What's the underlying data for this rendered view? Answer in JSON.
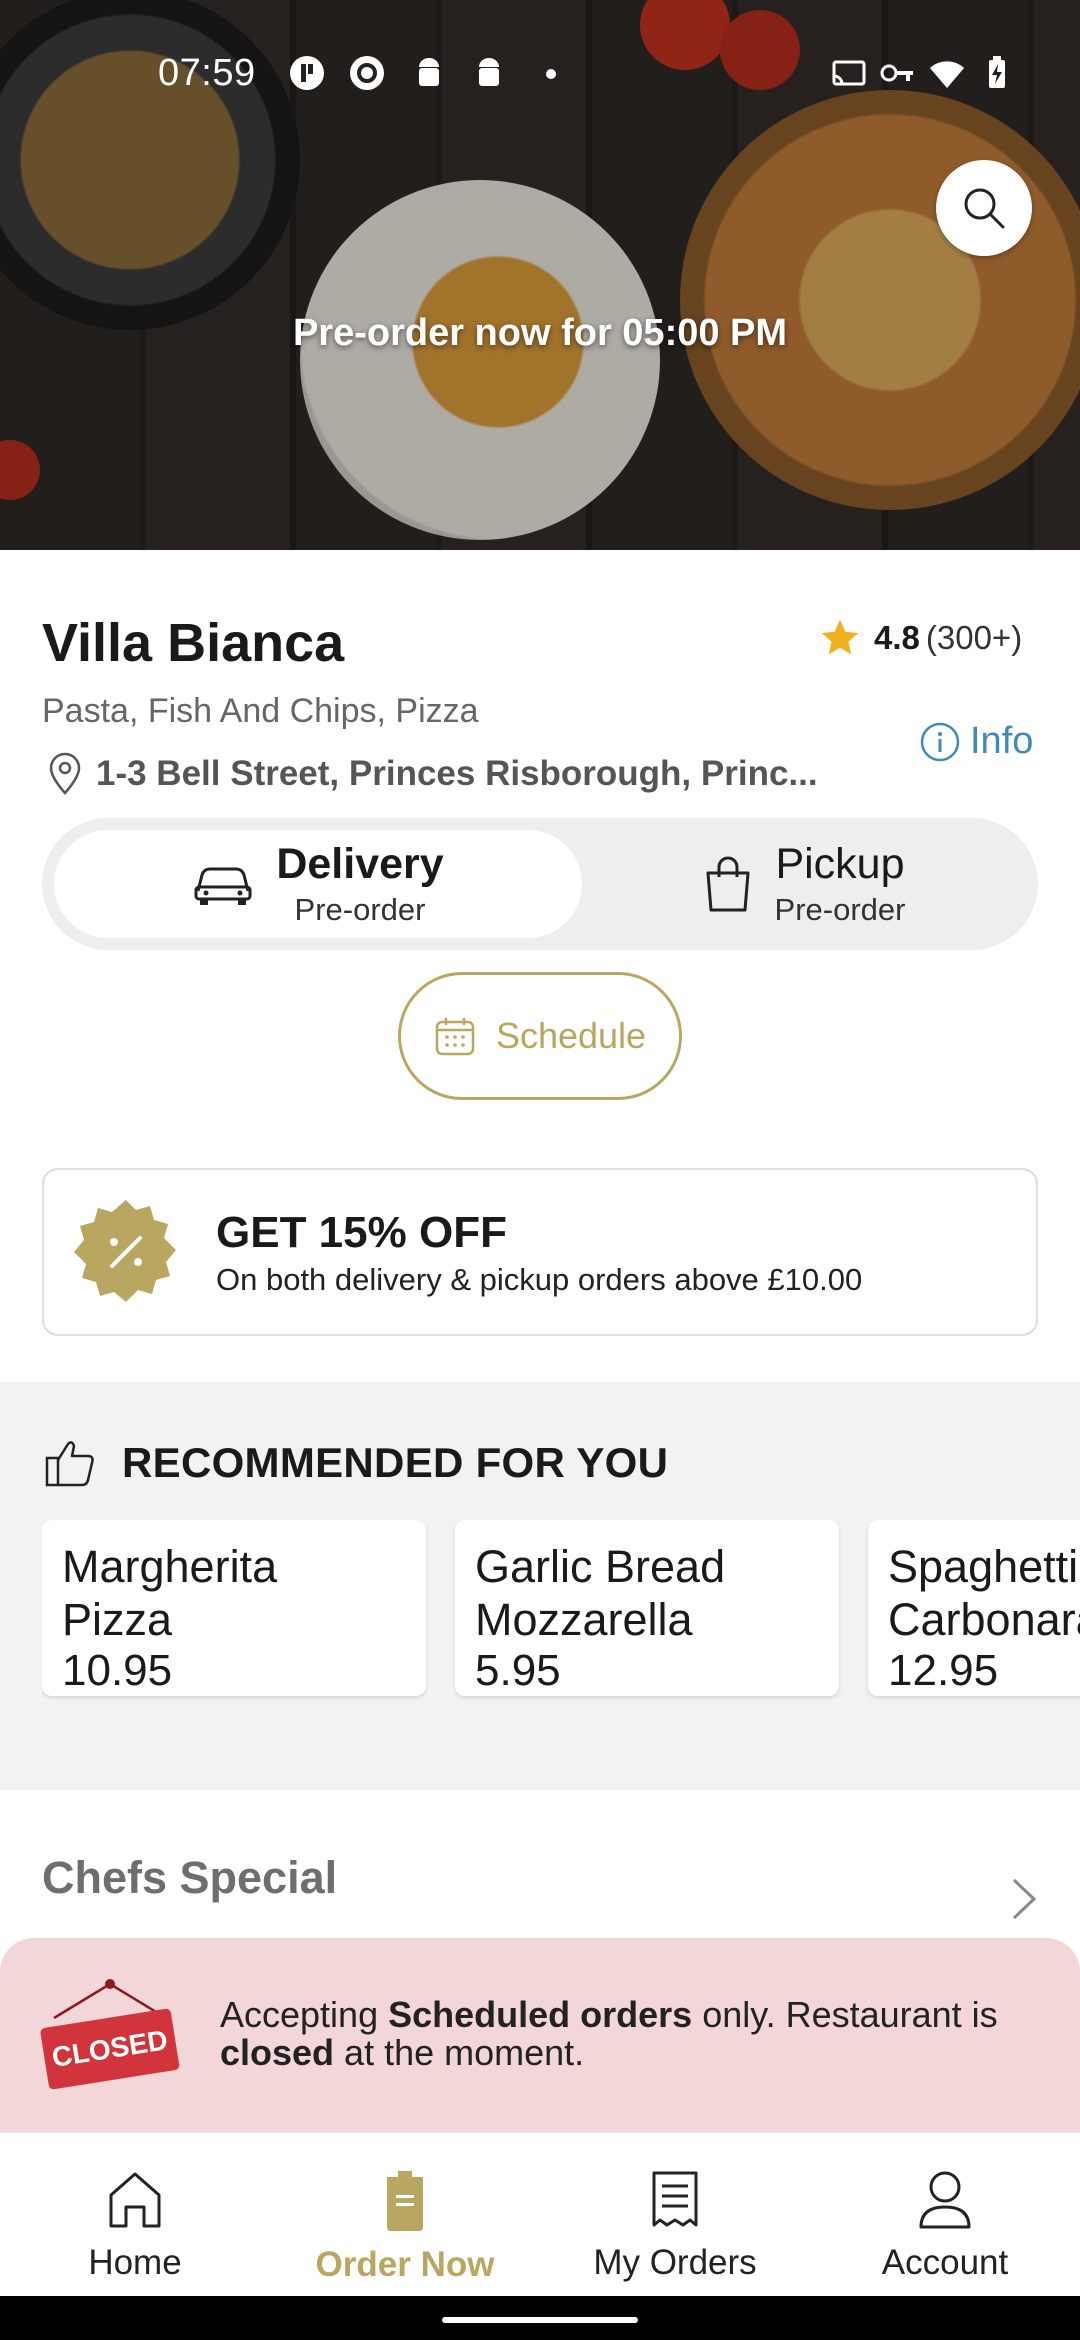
{
  "status_bar": {
    "time": "07:59"
  },
  "hero": {
    "preorder_text": "Pre-order now for 05:00 PM"
  },
  "restaurant": {
    "name": "Villa Bianca",
    "rating": "4.8",
    "rating_count": "(300+)",
    "cuisines": "Pasta, Fish And Chips, Pizza",
    "address": "1-3 Bell Street, Princes Risborough, Princ...",
    "info_label": "Info"
  },
  "order_mode": {
    "delivery": {
      "title": "Delivery",
      "subtitle": "Pre-order"
    },
    "pickup": {
      "title": "Pickup",
      "subtitle": "Pre-order"
    },
    "selected": "Delivery"
  },
  "schedule": {
    "label": "Schedule"
  },
  "promo": {
    "title": "GET 15% OFF",
    "subtitle": "On both delivery & pickup orders above £10.00"
  },
  "recommended": {
    "heading": "RECOMMENDED FOR YOU",
    "items": [
      {
        "name": "Margherita\nPizza",
        "price": "10.95"
      },
      {
        "name": "Garlic Bread\nMozzarella",
        "price": "5.95"
      },
      {
        "name": "Spaghetti\nCarbonara",
        "price": "12.95"
      }
    ]
  },
  "section": {
    "title": "Chefs Special"
  },
  "closed_banner": {
    "sign_text": "CLOSED",
    "part1": "Accepting ",
    "bold1": "Scheduled orders",
    "part2": " only. Restaurant is ",
    "bold2": "closed",
    "part3": " at the moment."
  },
  "bottom_nav": {
    "items": [
      {
        "label": "Home",
        "icon": "home-icon"
      },
      {
        "label": "Order Now",
        "icon": "order-now-icon"
      },
      {
        "label": "My Orders",
        "icon": "receipt-icon"
      },
      {
        "label": "Account",
        "icon": "account-icon"
      }
    ],
    "active": "Order Now"
  },
  "colors": {
    "accent": "#b9a660",
    "link": "#3e8ab8",
    "star": "#f2b01e",
    "closed_bg": "#f2d6d8",
    "closed_sign": "#d2343c"
  }
}
